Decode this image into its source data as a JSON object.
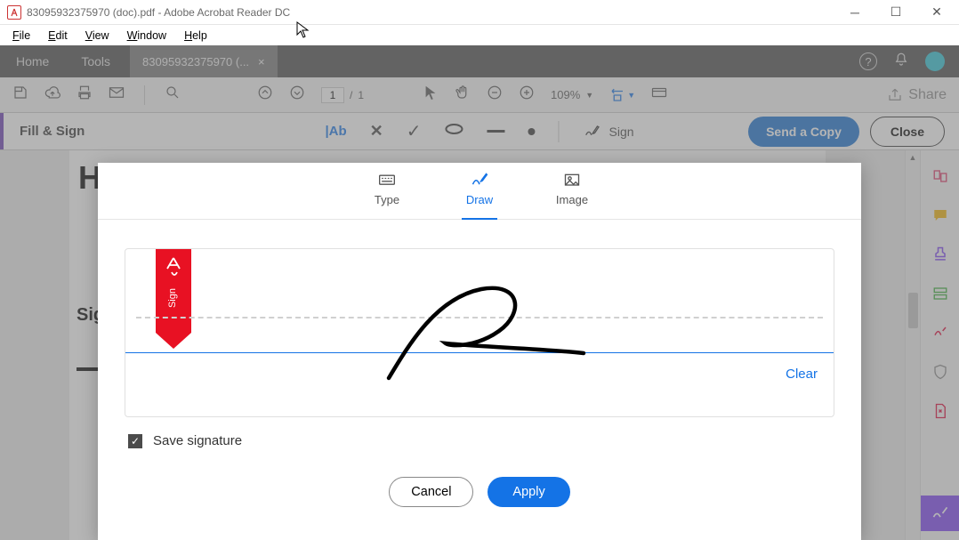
{
  "titlebar": {
    "text": "83095932375970 (doc).pdf - Adobe Acrobat Reader DC"
  },
  "menu": {
    "file": "File",
    "edit": "Edit",
    "view": "View",
    "window": "Window",
    "help": "Help"
  },
  "tabs": {
    "home": "Home",
    "tools": "Tools",
    "doc": "83095932375970 (...",
    "close": "×"
  },
  "toolbar": {
    "page_current": "1",
    "page_sep": "/",
    "page_total": "1",
    "zoom": "109%",
    "share": "Share"
  },
  "fillsign": {
    "title": "Fill & Sign",
    "sign": "Sign",
    "send": "Send a Copy",
    "close": "Close"
  },
  "doc": {
    "h": "H",
    "sig": "Sig"
  },
  "modal": {
    "tabs": {
      "type": "Type",
      "draw": "Draw",
      "image": "Image"
    },
    "ribbon": "Sign",
    "clear": "Clear",
    "save": "Save signature",
    "cancel": "Cancel",
    "apply": "Apply"
  }
}
